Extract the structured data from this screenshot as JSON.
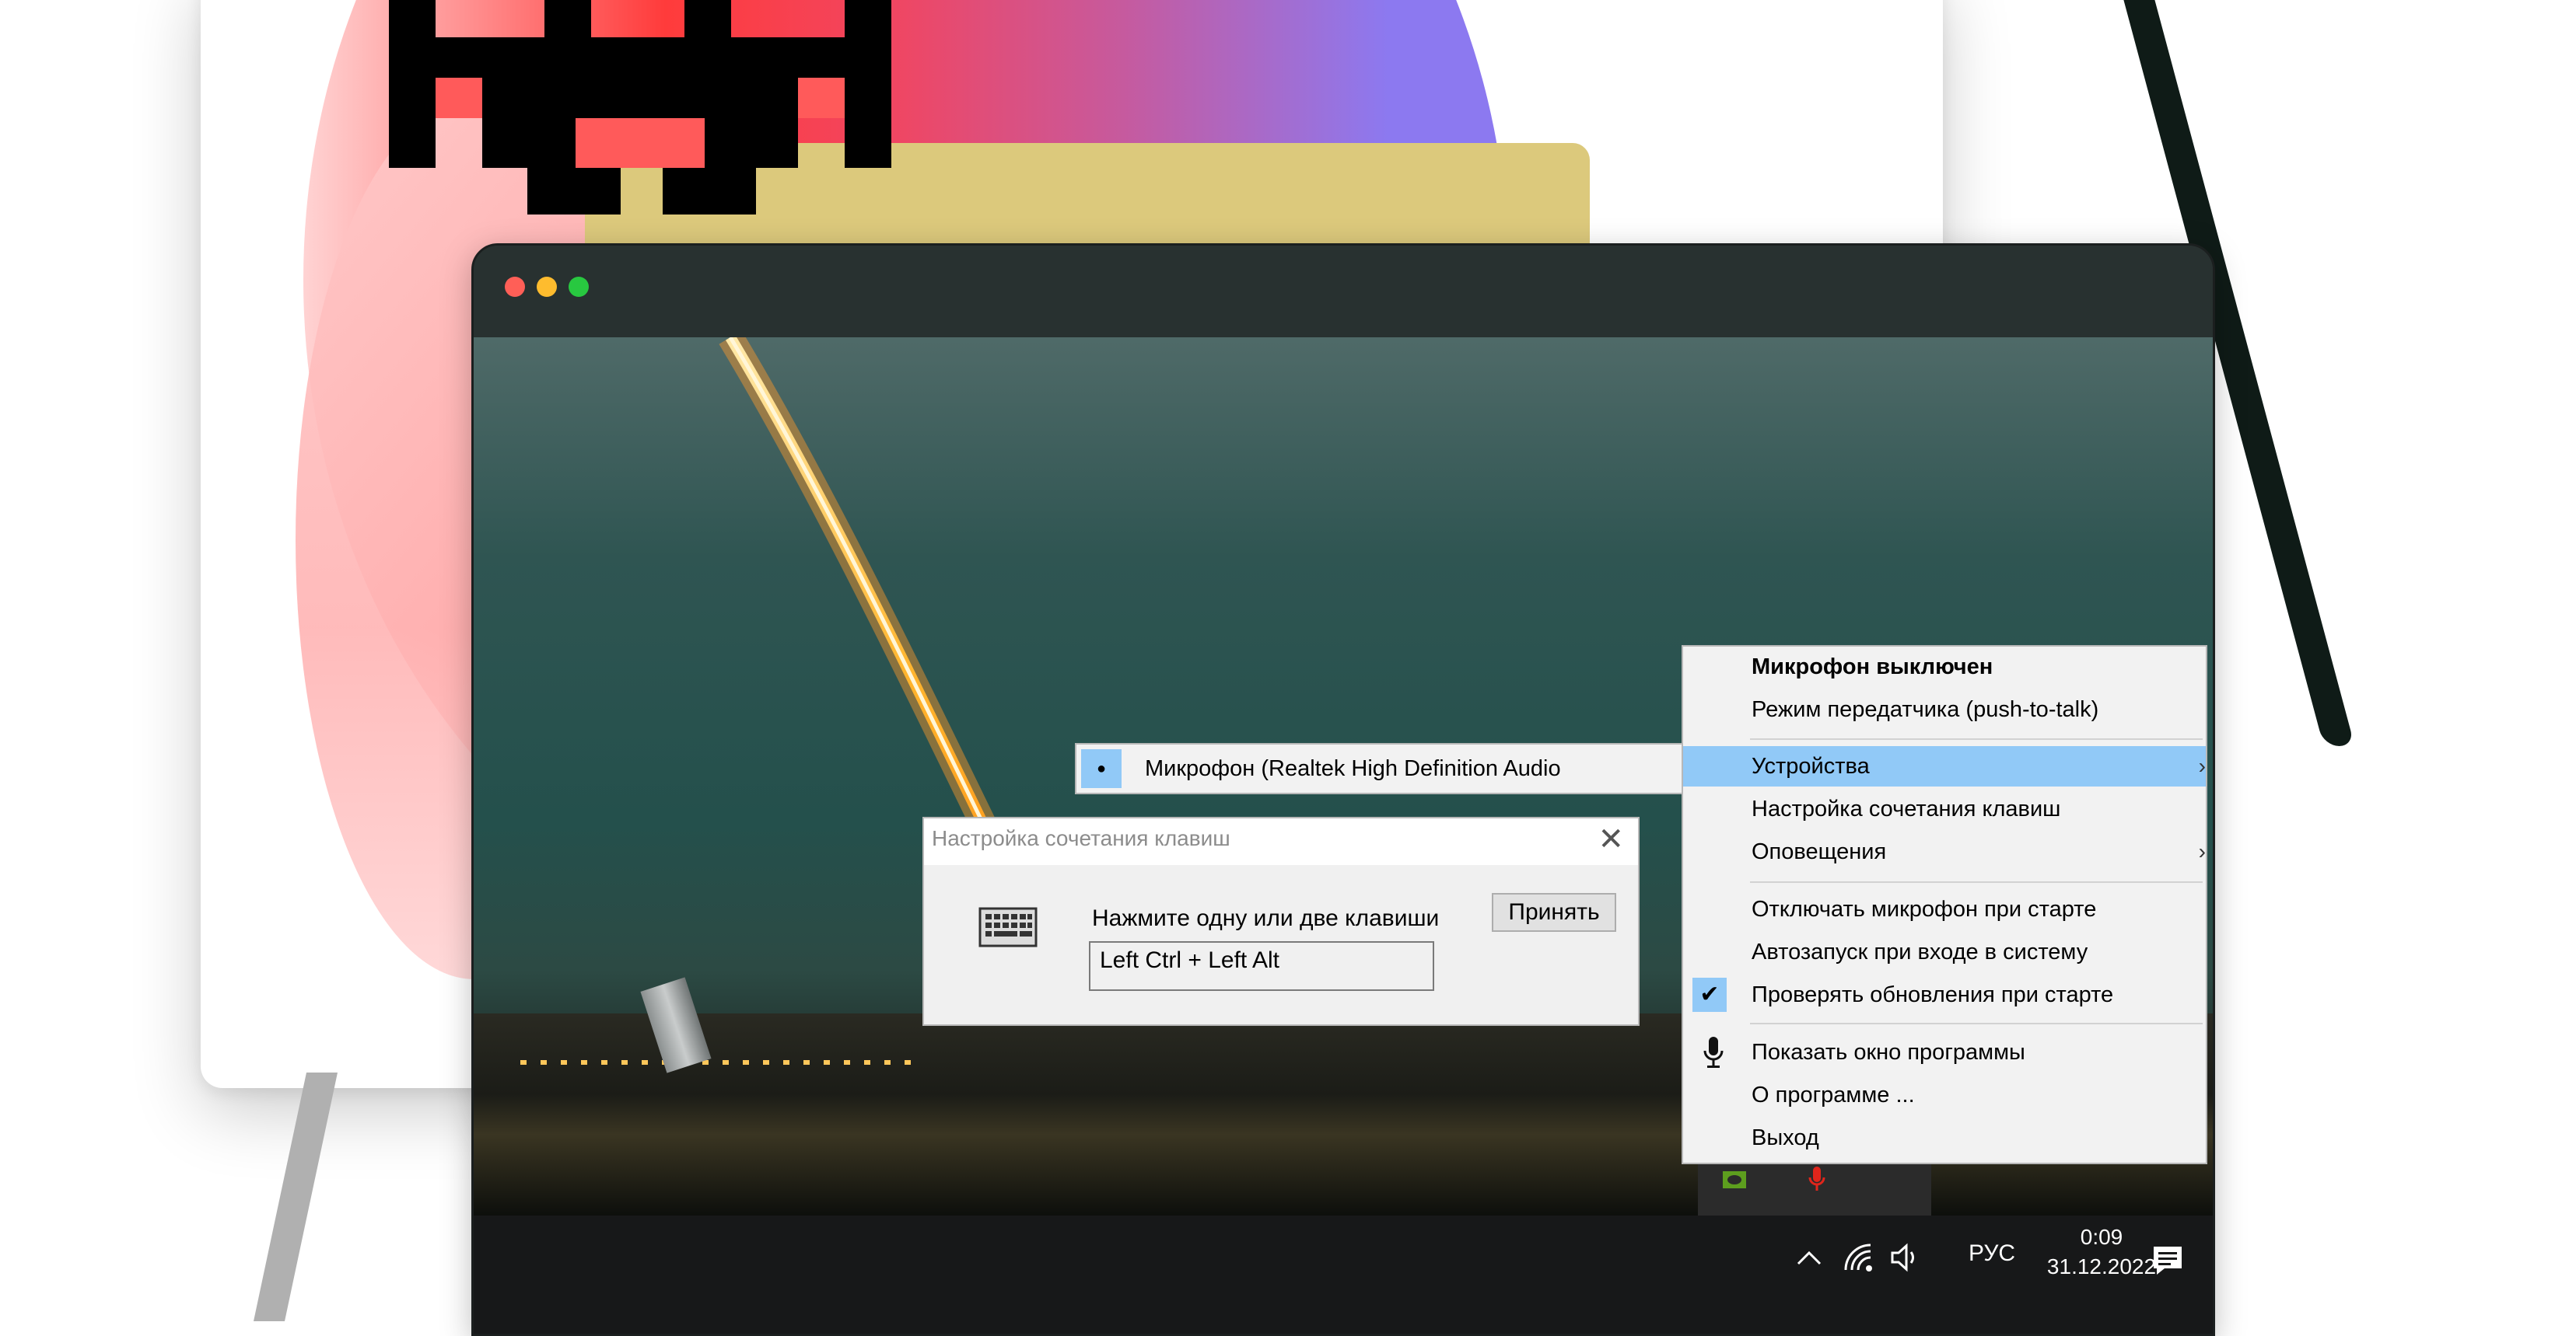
{
  "window_controls": [
    "close",
    "minimize",
    "maximize"
  ],
  "context_menu": {
    "status": "Микрофон выключен",
    "push_to_talk": "Режим передатчика (push-to-talk)",
    "devices": "Устройства",
    "hotkey_settings": "Настройка сочетания клавиш",
    "notifications": "Оповещения",
    "mute_on_start": "Отключать микрофон при старте",
    "autostart": "Автозапуск при входе в систему",
    "check_updates": "Проверять обновления при старте",
    "check_updates_checked": true,
    "show_window": "Показать окно программы",
    "about": "О программе ...",
    "exit": "Выход",
    "submenu_arrow": "›",
    "checkmark": "✔",
    "show_window_icon": "microphone-icon"
  },
  "devices_submenu": {
    "item": "Микрофон (Realtek High Definition Audio",
    "selected_marker": "●"
  },
  "hotkey_dialog": {
    "title": "Настройка сочетания клавиш",
    "close_glyph": "✕",
    "prompt": "Нажмите одну или две клавиши",
    "value": "Left Ctrl + Left Alt",
    "accept_button": "Принять",
    "icon": "keyboard-icon"
  },
  "taskbar": {
    "language": "РУС",
    "time": "0:09",
    "date": "31.12.2022",
    "tray_icons": [
      "chevron-up-icon",
      "network-icon",
      "volume-icon",
      "notification-icon"
    ],
    "tray_popup_icons": [
      "nvidia-icon",
      "microphone-muted-icon"
    ]
  },
  "colors": {
    "menu_highlight": "#91c9f7",
    "menu_background": "#f2f2f2",
    "taskbar": "#171819",
    "window_titlebar": "#283130",
    "close_red": "#ff5f57",
    "minimize_yellow": "#febc2e",
    "maximize_green": "#28c840",
    "mic_muted_red": "#e0251b"
  }
}
